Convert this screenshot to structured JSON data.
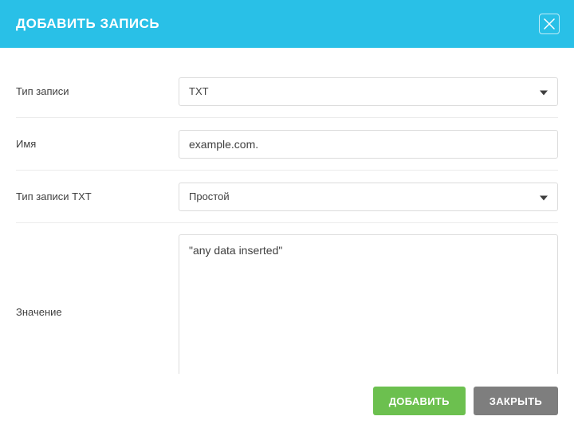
{
  "header": {
    "title": "ДОБАВИТЬ ЗАПИСЬ"
  },
  "form": {
    "record_type": {
      "label": "Тип записи",
      "value": "TXT"
    },
    "name": {
      "label": "Имя",
      "value": "example.com."
    },
    "txt_type": {
      "label": "Тип записи TXT",
      "value": "Простой"
    },
    "value": {
      "label": "Значение",
      "value": "\"any data inserted\""
    }
  },
  "footer": {
    "add": "ДОБАВИТЬ",
    "close": "ЗАКРЫТЬ"
  }
}
